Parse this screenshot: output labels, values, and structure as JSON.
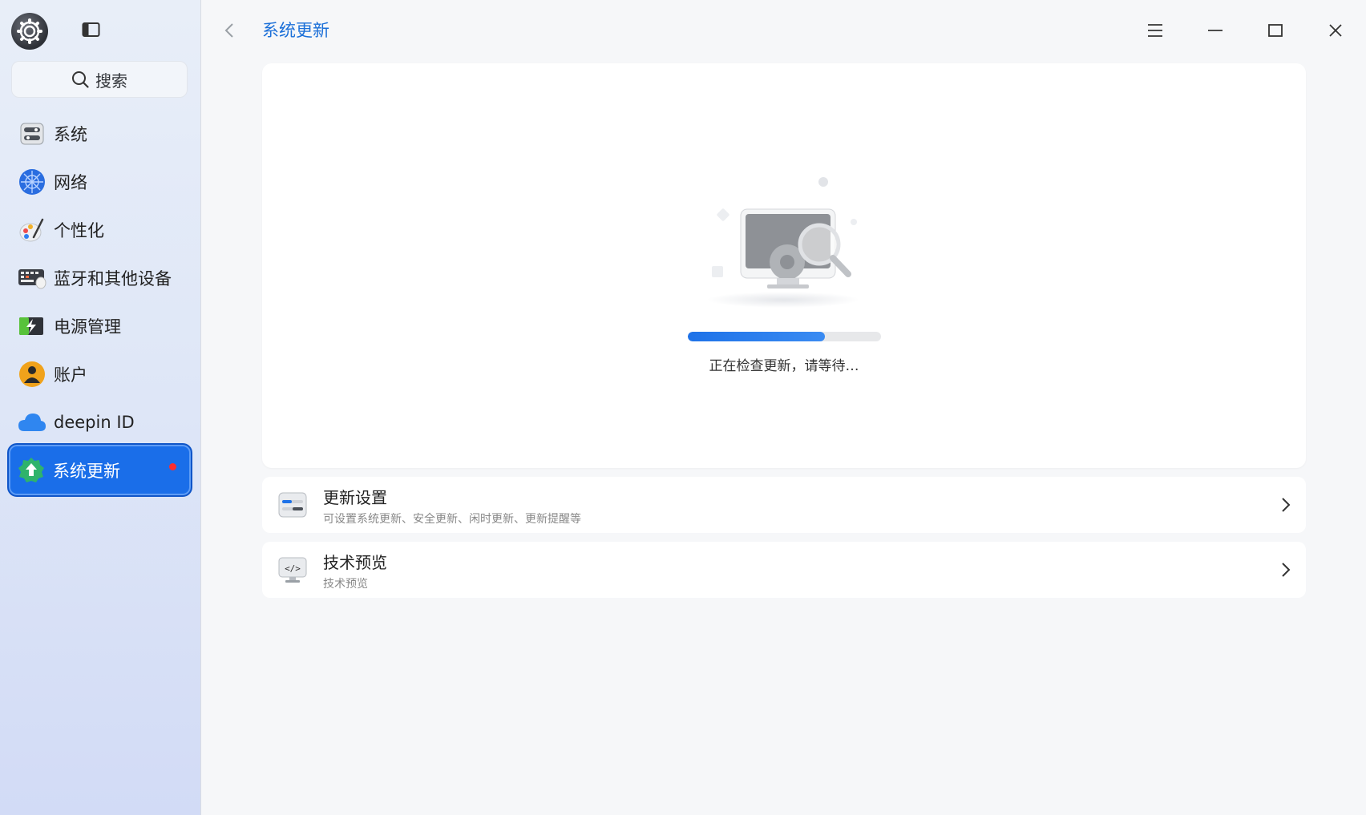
{
  "sidebar": {
    "search_placeholder": "搜索",
    "items": [
      {
        "label": "系统",
        "icon": "system-icon"
      },
      {
        "label": "网络",
        "icon": "network-icon"
      },
      {
        "label": "个性化",
        "icon": "personalization-icon"
      },
      {
        "label": "蓝牙和其他设备",
        "icon": "bluetooth-devices-icon"
      },
      {
        "label": "电源管理",
        "icon": "power-icon"
      },
      {
        "label": "账户",
        "icon": "account-icon"
      },
      {
        "label": "deepin ID",
        "icon": "cloud-icon"
      },
      {
        "label": "系统更新",
        "icon": "update-icon",
        "active": true,
        "has_badge": true
      }
    ]
  },
  "header": {
    "title": "系统更新"
  },
  "main": {
    "status": "正在检查更新，请等待…",
    "progress": 0.71,
    "rows": [
      {
        "title": "更新设置",
        "subtitle": "可设置系统更新、安全更新、闲时更新、更新提醒等",
        "icon": "update-settings-icon"
      },
      {
        "title": "技术预览",
        "subtitle": "技术预览",
        "icon": "code-preview-icon"
      }
    ]
  },
  "colors": {
    "accent": "#1a6ee9",
    "badge": "#ff2d2d",
    "title": "#1b6fd8"
  }
}
